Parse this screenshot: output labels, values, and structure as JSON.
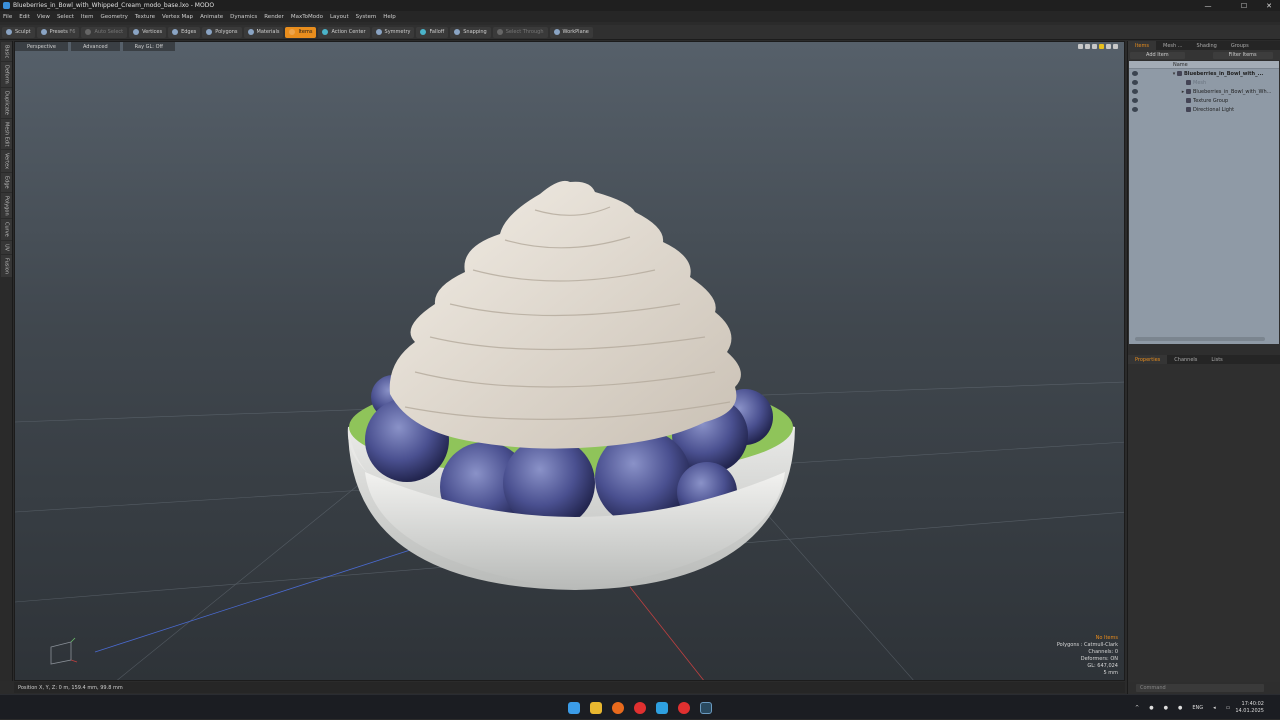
{
  "window": {
    "title": "Blueberries_in_Bowl_with_Whipped_Cream_modo_base.lxo - MODO",
    "min": "—",
    "max": "☐",
    "close": "✕"
  },
  "menu": [
    "File",
    "Edit",
    "View",
    "Select",
    "Item",
    "Geometry",
    "Texture",
    "Vertex Map",
    "Animate",
    "Dynamics",
    "Render",
    "MaxToModo",
    "Layout",
    "System",
    "Help"
  ],
  "toolbar": {
    "sculpt": "Sculpt",
    "presets": "Presets",
    "presets_key": "F6",
    "auto_select": "Auto Select",
    "vertices": "Vertices",
    "edges": "Edges",
    "polygons": "Polygons",
    "materials": "Materials",
    "items": "Items",
    "action_center": "Action Center",
    "symmetry": "Symmetry",
    "falloff": "Falloff",
    "snapping": "Snapping",
    "select_through": "Select Through",
    "workplane": "WorkPlane"
  },
  "left_tabs": [
    "Basic",
    "Deform",
    "Duplicate",
    "Mesh Edit",
    "Vertex",
    "Edge",
    "Polygon",
    "Curve",
    "UV",
    "Fusion"
  ],
  "viewport": {
    "tabs": [
      "Perspective",
      "Advanced",
      "Ray GL: Off"
    ],
    "hud": {
      "selection": "No Items",
      "polygons": "Polygons : Catmull-Clark",
      "channels": "Channels: 0",
      "deformers": "Deformers: ON",
      "gl": "GL: 647,024",
      "unit": "5 mm"
    }
  },
  "statusbar": {
    "position": "Position X, Y, Z:  0 m, 159.4 mm, 99.8 mm"
  },
  "right_panel": {
    "tabs": [
      "Items",
      "Mesh ...",
      "Shading",
      "Groups"
    ],
    "add_item": "Add Item",
    "filter_items": "Filter Items",
    "column_name": "Name",
    "tree": [
      {
        "label": "Blueberries_in_Bowl_with_...",
        "indent": 0,
        "tri": "▾",
        "bold": true,
        "dim": false
      },
      {
        "label": "Mesh",
        "indent": 1,
        "tri": "",
        "bold": false,
        "dim": true
      },
      {
        "label": "Blueberries_in_Bowl_with_Wh...",
        "indent": 1,
        "tri": "▸",
        "bold": false,
        "dim": false
      },
      {
        "label": "Texture Group",
        "indent": 1,
        "tri": "",
        "bold": false,
        "dim": false
      },
      {
        "label": "Directional Light",
        "indent": 1,
        "tri": "",
        "bold": false,
        "dim": false
      }
    ],
    "props_tabs": [
      "Properties",
      "Channels",
      "Lists"
    ],
    "command_placeholder": "Command"
  },
  "taskbar": {
    "lang": "ENG",
    "time": "17:40:02",
    "date": "14.01.2025"
  },
  "colors": {
    "accent": "#e88d1d",
    "viewport_top": "#56606a",
    "viewport_bottom": "#2e3338",
    "items_panel": "#8f9aa6"
  }
}
